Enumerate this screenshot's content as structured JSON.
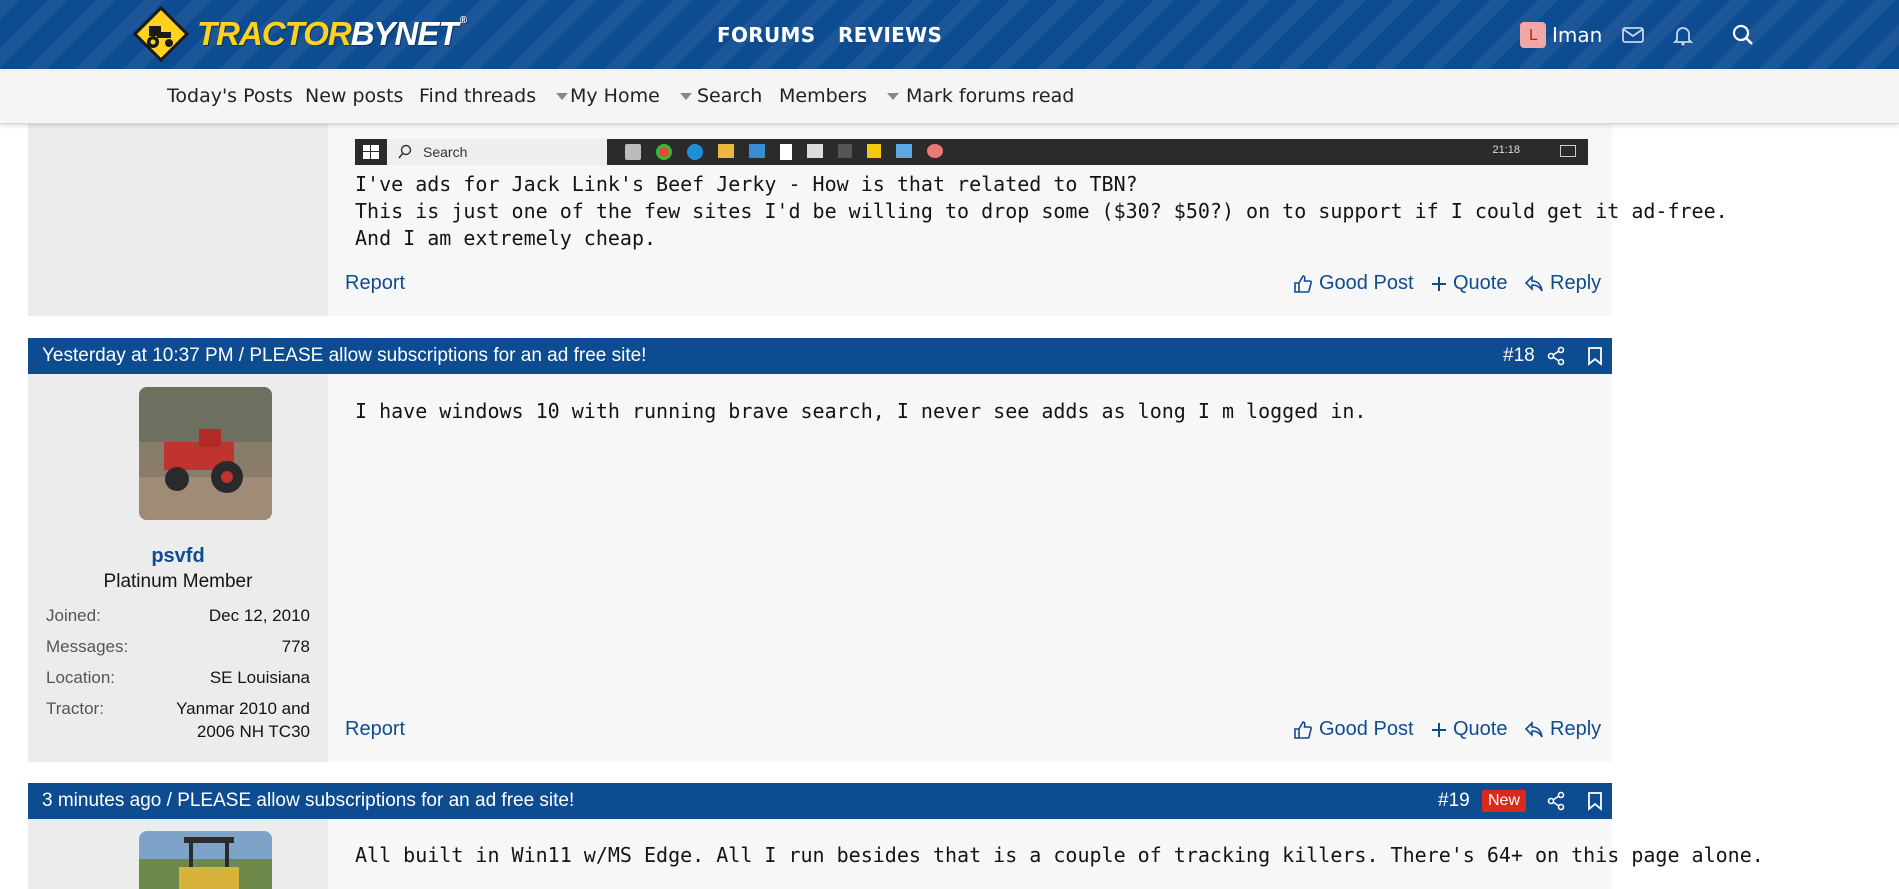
{
  "header": {
    "logo_text_main": "TRACTOR",
    "logo_text_accent": "BYNET",
    "logo_trademark": "®",
    "nav": [
      {
        "label": "FORUMS"
      },
      {
        "label": "REVIEWS"
      }
    ],
    "user": {
      "initial": "L",
      "name": "Iman"
    },
    "icons": [
      "envelope-icon",
      "bell-icon",
      "search-icon"
    ],
    "brand_color": "#0e4c92",
    "logo_color": "#ffd21f"
  },
  "subnav": {
    "items": [
      {
        "label": "Today's Posts"
      },
      {
        "label": "New posts"
      },
      {
        "label": "Find threads"
      },
      {
        "label": "My Home"
      },
      {
        "label": "Search"
      },
      {
        "label": "Members"
      },
      {
        "label": "Mark forums read"
      }
    ]
  },
  "taskbar": {
    "search_label": "Search",
    "time": "21:18"
  },
  "post17": {
    "lines": [
      "I've ads for Jack Link's Beef Jerky - How is that related to TBN?",
      "This is just one of the few sites I'd be willing to drop some ($30? $50?) on to support if I could get it ad-free.",
      "And I am extremely cheap."
    ]
  },
  "post18": {
    "header": "Yesterday at 10:37 PM / PLEASE allow subscriptions for an ad free site!",
    "number": "#18",
    "username": "psvfd",
    "user_title": "Platinum Member",
    "stats": [
      {
        "label": "Joined:",
        "value": "Dec 12, 2010"
      },
      {
        "label": "Messages:",
        "value": "778"
      },
      {
        "label": "Location:",
        "value": "SE Louisiana"
      },
      {
        "label": "Tractor:",
        "value": "Yanmar 2010 and"
      },
      {
        "label": "",
        "value": "2006 NH TC30"
      }
    ],
    "body": "I have windows 10 with running brave search, I never see adds as long I m logged in."
  },
  "post19": {
    "header": "3 minutes ago / PLEASE allow subscriptions for an ad free site!",
    "number": "#19",
    "badge": "New",
    "body": "All built in Win11 w/MS Edge. All I run besides that is a couple of tracking killers. There's 64+ on this page alone."
  },
  "actions": {
    "report": "Report",
    "good_post": "Good Post",
    "quote": "Quote",
    "reply": "Reply"
  }
}
